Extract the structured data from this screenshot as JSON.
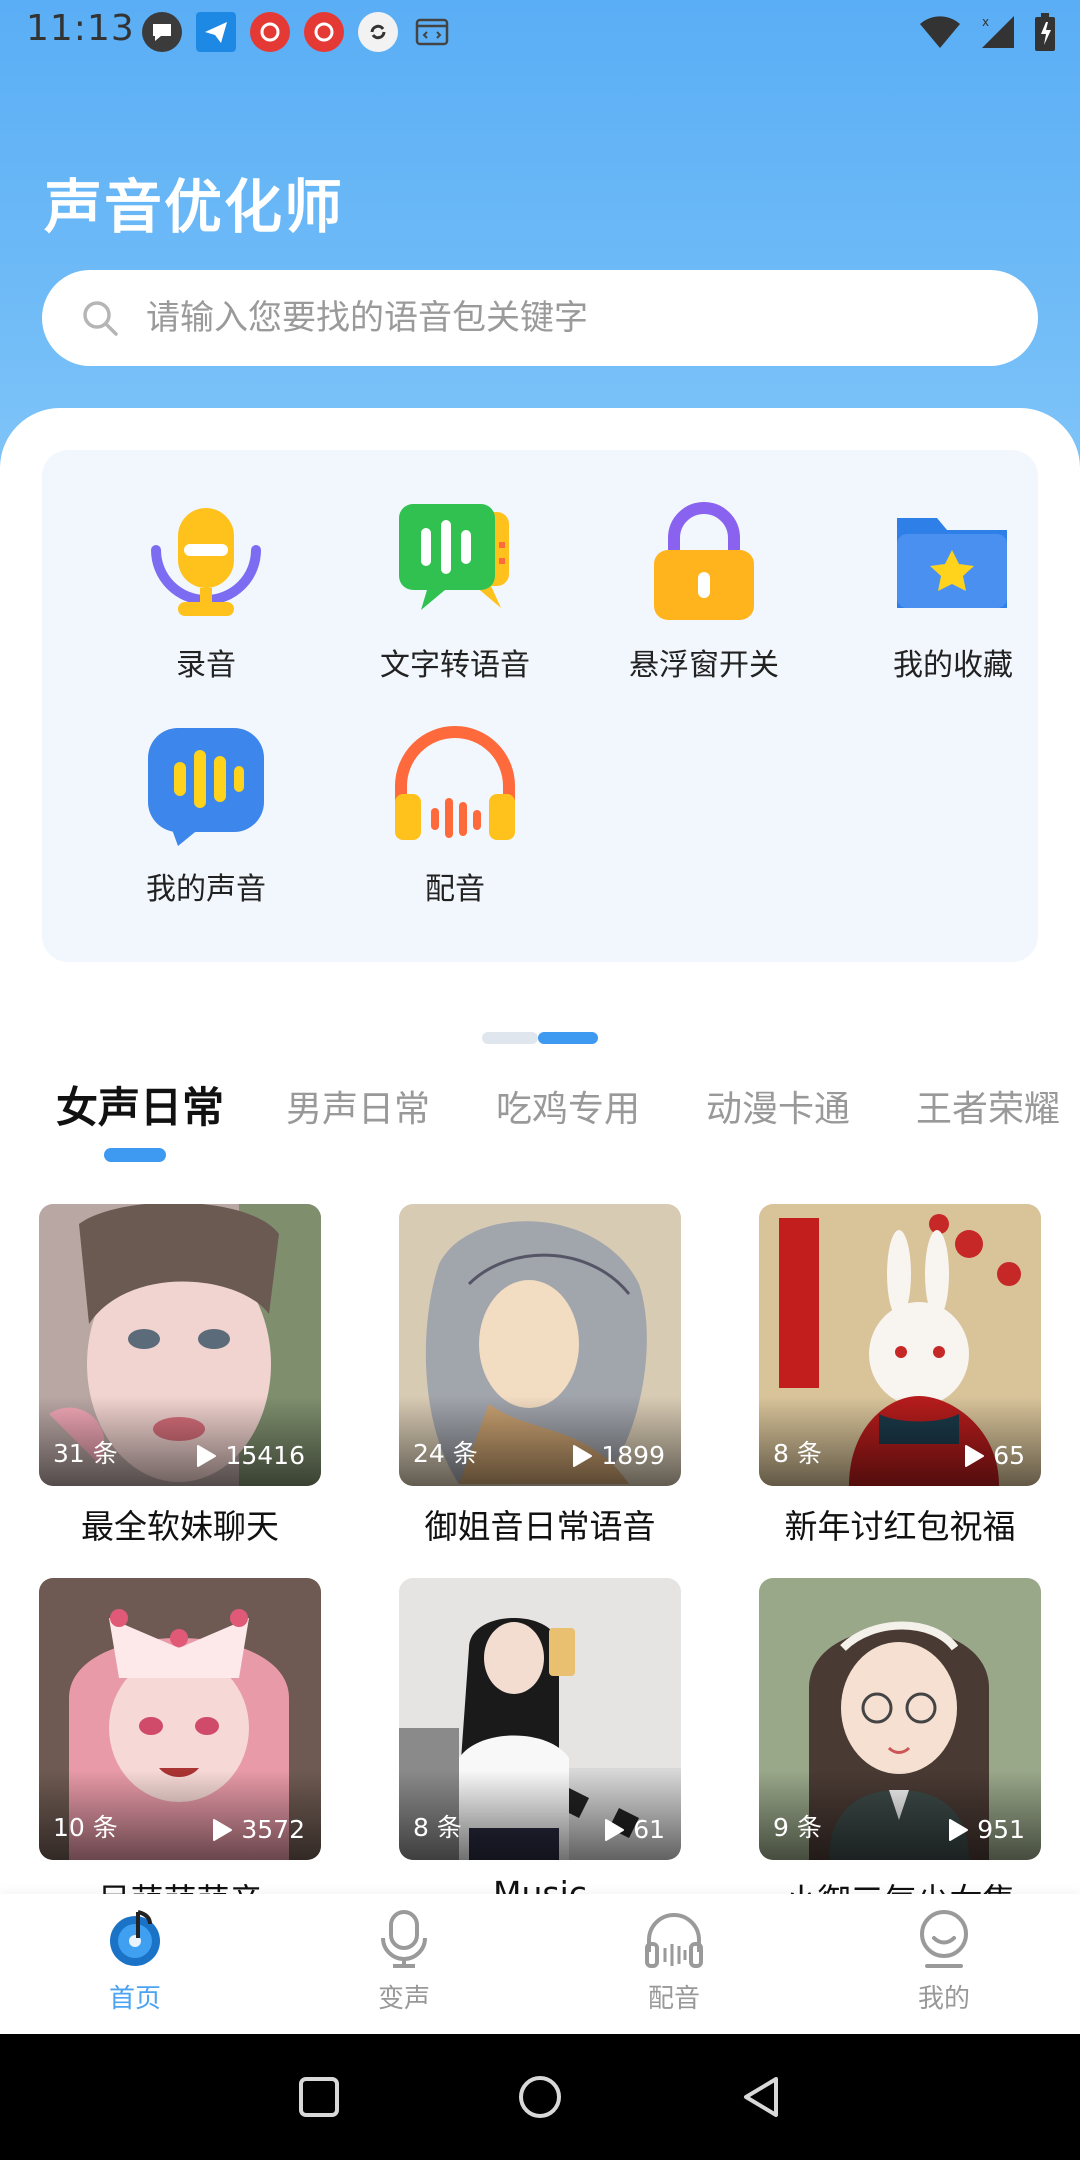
{
  "status_bar": {
    "time": "11:13"
  },
  "app": {
    "title": "声音优化师"
  },
  "search": {
    "placeholder": "请输入您要找的语音包关键字"
  },
  "tools": [
    {
      "label": "录音",
      "icon": "microphone-icon"
    },
    {
      "label": "文字转语音",
      "icon": "text-to-speech-icon"
    },
    {
      "label": "悬浮窗开关",
      "icon": "lock-icon"
    },
    {
      "label": "我的收藏",
      "icon": "star-folder-icon"
    },
    {
      "label": "我的声音",
      "icon": "voice-bubble-icon"
    },
    {
      "label": "配音",
      "icon": "headphones-icon"
    }
  ],
  "tabs": [
    "女声日常",
    "男声日常",
    "吃鸡专用",
    "动漫卡通",
    "王者荣耀"
  ],
  "cards": [
    {
      "count": "31 条",
      "plays": "15416",
      "title": "最全软妹聊天"
    },
    {
      "count": "24 条",
      "plays": "1899",
      "title": "御姐音日常语音"
    },
    {
      "count": "8 条",
      "plays": "65",
      "title": "新年讨红包祝福"
    },
    {
      "count": "10 条",
      "plays": "3572",
      "title": "呆萌萌萌音"
    },
    {
      "count": "8 条",
      "plays": "61",
      "title": "Music"
    },
    {
      "count": "9 条",
      "plays": "951",
      "title": "小御三气少女集"
    }
  ],
  "bottom_nav": [
    {
      "label": "首页",
      "icon": "home-disc-icon"
    },
    {
      "label": "变声",
      "icon": "microphone-icon"
    },
    {
      "label": "配音",
      "icon": "headphones-icon"
    },
    {
      "label": "我的",
      "icon": "profile-icon"
    }
  ],
  "colors": {
    "accent": "#3d9af0",
    "hero": "#5aaef5"
  }
}
